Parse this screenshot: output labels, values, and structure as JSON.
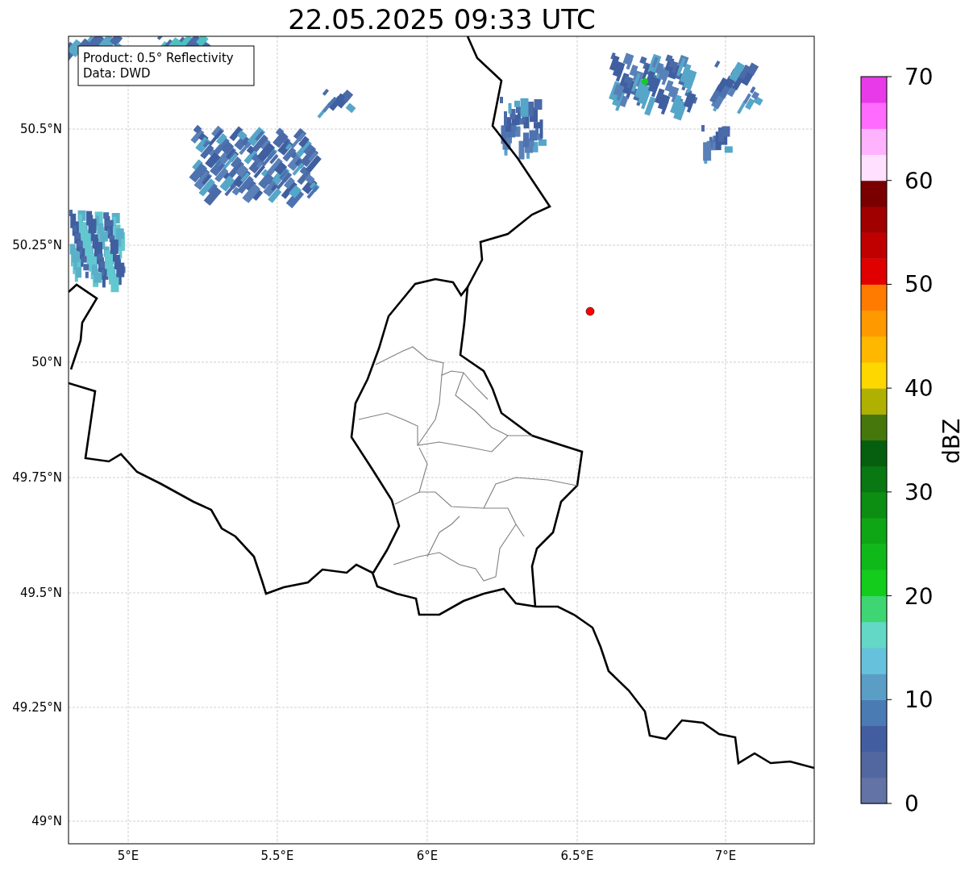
{
  "title": "22.05.2025 09:33 UTC",
  "legend": [
    "Product: 0.5° Reflectivity",
    "Data: DWD"
  ],
  "y_ticks": [
    "50.5°N",
    "50.25°N",
    "50°N",
    "49.75°N",
    "49.5°N",
    "49.25°N",
    "49°N"
  ],
  "x_ticks": [
    "5°E",
    "5.5°E",
    "6°E",
    "6.5°E",
    "7°E"
  ],
  "colorbar": {
    "label": "dBZ",
    "ticks": [
      "70",
      "60",
      "50",
      "40",
      "30",
      "20",
      "10",
      "0"
    ],
    "bands": [
      {
        "color": "#6473a6"
      },
      {
        "color": "#52679f"
      },
      {
        "color": "#435ea0"
      },
      {
        "color": "#4a7bb3"
      },
      {
        "color": "#5a9ec6"
      },
      {
        "color": "#66c2dc"
      },
      {
        "color": "#63d8c6"
      },
      {
        "color": "#3ed673"
      },
      {
        "color": "#13cc1c"
      },
      {
        "color": "#10b91a"
      },
      {
        "color": "#0ea615"
      },
      {
        "color": "#0b8e12"
      },
      {
        "color": "#097812"
      },
      {
        "color": "#065f0e"
      },
      {
        "color": "#46770d"
      },
      {
        "color": "#b0b001"
      },
      {
        "color": "#ffd700"
      },
      {
        "color": "#ffb700"
      },
      {
        "color": "#ff9900"
      },
      {
        "color": "#ff7b00"
      },
      {
        "color": "#e00000"
      },
      {
        "color": "#c00000"
      },
      {
        "color": "#a00000"
      },
      {
        "color": "#7a0000"
      },
      {
        "color": "#ffe1ff"
      },
      {
        "color": "#ffb3ff"
      },
      {
        "color": "#ff6aff"
      },
      {
        "color": "#e83ae8"
      }
    ]
  }
}
